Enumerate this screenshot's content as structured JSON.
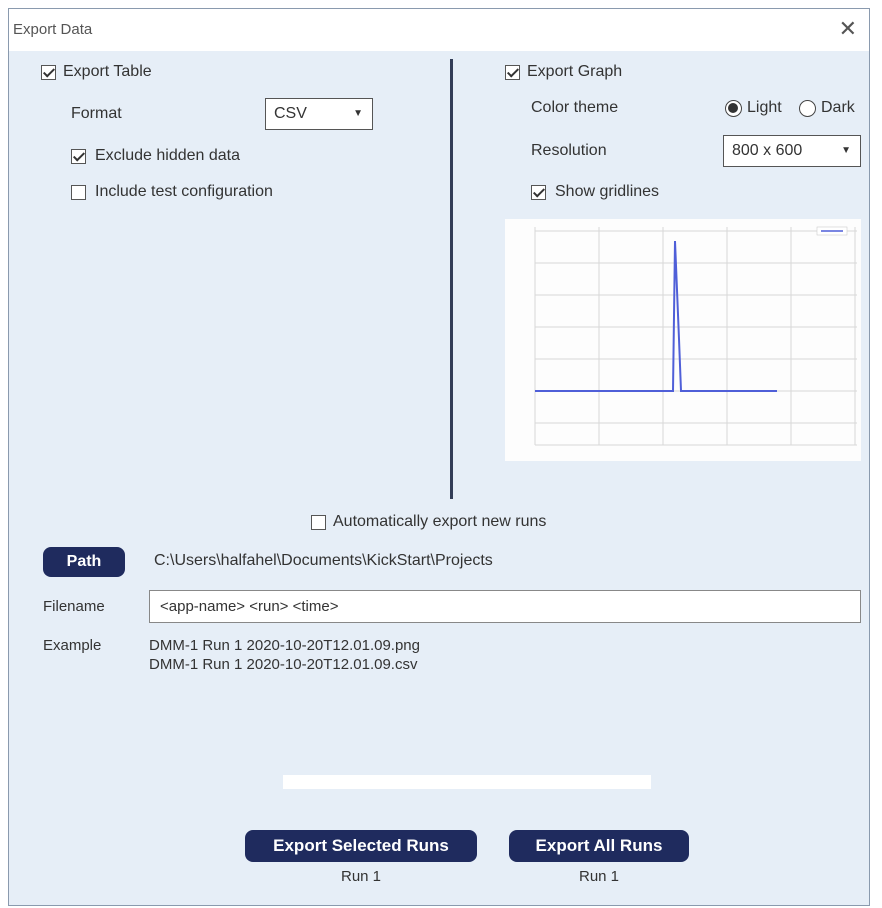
{
  "window": {
    "title": "Export Data",
    "close_icon": "close-icon"
  },
  "table": {
    "export_label": "Export Table",
    "export_checked": true,
    "format_label": "Format",
    "format_value": "CSV",
    "exclude_hidden_label": "Exclude hidden data",
    "exclude_hidden_checked": true,
    "include_config_label": "Include test configuration",
    "include_config_checked": false
  },
  "graph": {
    "export_label": "Export Graph",
    "export_checked": true,
    "color_theme_label": "Color theme",
    "theme_options": [
      "Light",
      "Dark"
    ],
    "theme_selected": "Light",
    "resolution_label": "Resolution",
    "resolution_value": "800 x 600",
    "gridlines_label": "Show gridlines",
    "gridlines_checked": true,
    "preview_color": "#4f5fd8"
  },
  "auto_export": {
    "label": "Automatically export new runs",
    "checked": false
  },
  "path": {
    "button_label": "Path",
    "value": "C:\\Users\\halfahel\\Documents\\KickStart\\Projects"
  },
  "filename": {
    "label": "Filename",
    "value": "<app-name> <run> <time>"
  },
  "example": {
    "label": "Example",
    "lines": [
      "DMM-1 Run 1 2020-10-20T12.01.09.png",
      "DMM-1 Run 1 2020-10-20T12.01.09.csv"
    ]
  },
  "progress": {
    "value": 0
  },
  "actions": {
    "export_selected_label": "Export Selected Runs",
    "export_selected_sub": "Run 1",
    "export_all_label": "Export All Runs",
    "export_all_sub": "Run 1"
  },
  "colors": {
    "accent": "#1f2b5e",
    "background": "#e6eef7"
  }
}
